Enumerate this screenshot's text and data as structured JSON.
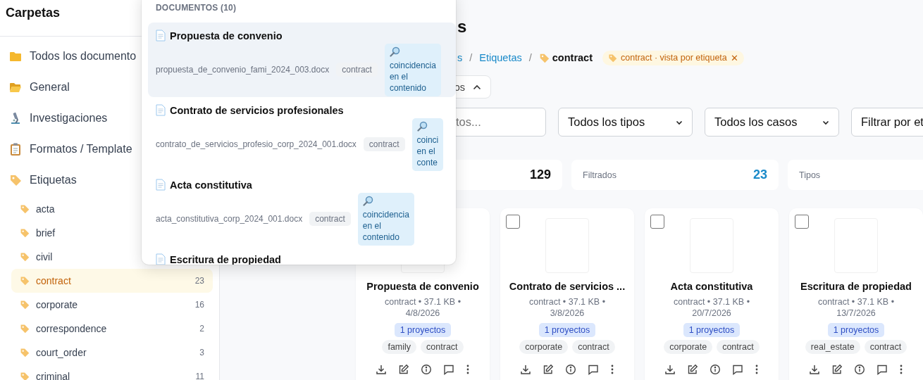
{
  "sidebar": {
    "title": "Carpetas",
    "folders": [
      {
        "label": "Todos los documento",
        "selected": false
      },
      {
        "label": "General",
        "selected": false
      },
      {
        "label": "Investigaciones",
        "selected": false
      },
      {
        "label": "Formatos / Template",
        "selected": false
      },
      {
        "label": "Etiquetas",
        "selected": false
      }
    ],
    "tags": [
      {
        "label": "acta",
        "selected": false
      },
      {
        "label": "brief",
        "selected": false
      },
      {
        "label": "civil",
        "selected": false
      },
      {
        "label": "contract",
        "count": "23",
        "selected": true
      },
      {
        "label": "corporate",
        "count": "16",
        "selected": false
      },
      {
        "label": "correspondence",
        "count": "2",
        "selected": false
      },
      {
        "label": "court_order",
        "count": "3",
        "selected": false
      },
      {
        "label": "criminal",
        "count": "11",
        "selected": false
      }
    ]
  },
  "search_popup": {
    "header": "DOCUMENTOS (10)",
    "results": [
      {
        "title": "Propuesta de convenio",
        "filename": "propuesta_de_convenio_fami_2024_003.docx",
        "tag": "contract",
        "match": "coincidencia en el contenido",
        "selected": true
      },
      {
        "title": "Contrato de servicios profesionales",
        "filename": "contrato_de_servicios_profesio_corp_2024_001.docx",
        "tag": "contract",
        "match": "coinci en el conte",
        "selected": false
      },
      {
        "title": "Acta constitutiva",
        "filename": "acta_constitutiva_corp_2024_001.docx",
        "tag": "contract",
        "match": "coincidencia en el contenido",
        "selected": false
      },
      {
        "title": "Escritura de propiedad",
        "selected": false
      }
    ]
  },
  "page": {
    "title": "s",
    "breadcrumb": [
      {
        "label": "s",
        "kind": "link"
      },
      {
        "label": "/",
        "kind": "separator"
      },
      {
        "label": "Etiquetas",
        "kind": "link"
      },
      {
        "label": "/",
        "kind": "separator"
      },
      {
        "label": "contract",
        "kind": "current"
      }
    ],
    "filter_chip": {
      "label": "contract · vista por etiqueta",
      "close": "✕"
    },
    "toggle": {
      "label": "os",
      "expanded": true
    },
    "search": {
      "placeholder": "tos..."
    },
    "filters": [
      {
        "kind": "select",
        "value": "Todos los tipos"
      },
      {
        "kind": "select",
        "value": "Todos los casos"
      },
      {
        "kind": "input",
        "value": "Filtrar por et"
      }
    ],
    "stats": [
      {
        "kind": "total",
        "value": "129"
      },
      {
        "kind": "filtered",
        "label": "Filtrados",
        "value": "23"
      },
      {
        "kind": "plain",
        "label": "Tipos"
      }
    ],
    "documents": [
      {
        "title": "Propuesta de convenio",
        "meta": "contract • 37.1 KB • 4/8/2026",
        "projects": "1 proyectos",
        "tags": [
          "family",
          "contract"
        ]
      },
      {
        "checked": false,
        "title": "Contrato de servicios ...",
        "meta": "contract • 37.1 KB • 3/8/2026",
        "projects": "1 proyectos",
        "tags": [
          "corporate",
          "contract"
        ]
      },
      {
        "checked": false,
        "title": "Acta constitutiva",
        "meta": "contract • 37.1 KB • 20/7/2026",
        "projects": "1 proyectos",
        "tags": [
          "corporate",
          "contract"
        ]
      },
      {
        "checked": false,
        "title": "Escritura de propiedad",
        "meta": "contract • 37.1 KB • 13/7/2026",
        "projects": "1 proyectos",
        "tags": [
          "real_estate",
          "contract"
        ]
      }
    ]
  }
}
